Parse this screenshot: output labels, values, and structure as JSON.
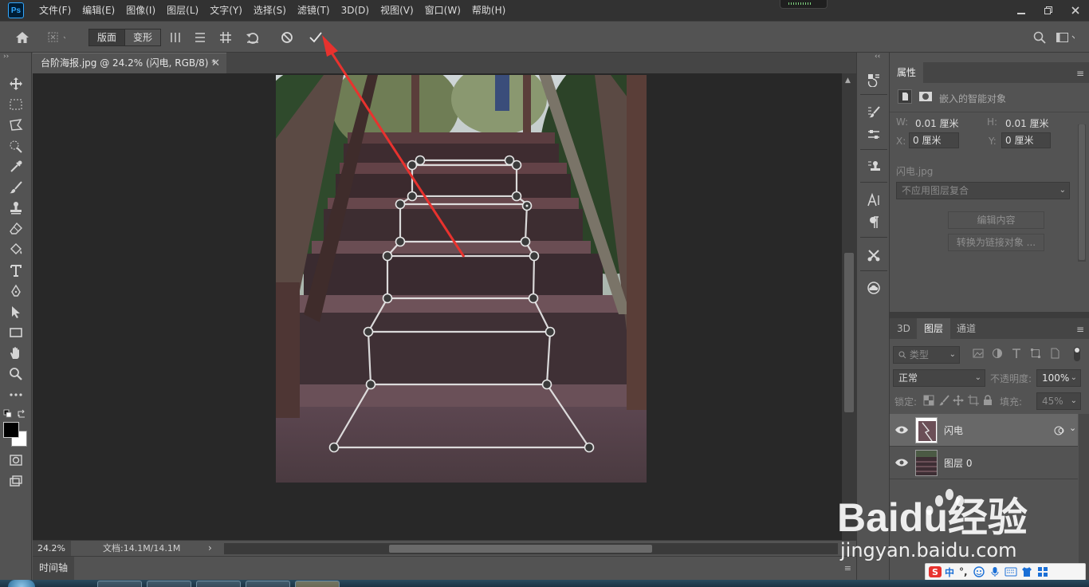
{
  "app": {
    "logo": "Ps",
    "menu": [
      "文件(F)",
      "编辑(E)",
      "图像(I)",
      "图层(L)",
      "文字(Y)",
      "选择(S)",
      "滤镜(T)",
      "3D(D)",
      "视图(V)",
      "窗口(W)",
      "帮助(H)"
    ],
    "window_controls": [
      "minimize",
      "restore",
      "close"
    ]
  },
  "options_bar": {
    "mode_segments": [
      "版面",
      "变形"
    ],
    "active_segment": "版面",
    "icons": [
      "home-icon",
      "puppet-warp-icon",
      "vertical-split-icon",
      "horizontal-split-icon",
      "grid-split-icon",
      "reset-icon",
      "cancel-icon",
      "commit-icon"
    ]
  },
  "document": {
    "tab_title": "台阶海报.jpg @ 24.2% (闪电, RGB/8) *",
    "zoom": "24.2%",
    "doc_size": "文档:14.1M/14.1M",
    "status_arrow": "›"
  },
  "timeline": {
    "tab_label": "时间轴"
  },
  "properties": {
    "tab": "属性",
    "subtitle": "嵌入的智能对象",
    "w_label": "W:",
    "w_value": "0.01 厘米",
    "h_label": "H:",
    "h_value": "0.01 厘米",
    "x_label": "X:",
    "x_value": "0 厘米",
    "y_label": "Y:",
    "y_value": "0 厘米",
    "filename": "闪电.jpg",
    "layer_comp": "不应用图层复合",
    "edit_button": "编辑内容",
    "convert_button": "转换为链接对象 ..."
  },
  "layers": {
    "tabs": [
      "3D",
      "图层",
      "通道"
    ],
    "active_tab": "图层",
    "filter_label": "类型",
    "blend_mode": "正常",
    "opacity_label": "不透明度:",
    "opacity_value": "100%",
    "lock_label": "锁定:",
    "fill_label": "填充:",
    "fill_value": "45%",
    "items": [
      {
        "name": "闪电",
        "selected": true
      },
      {
        "name": "图层 0",
        "selected": false
      }
    ]
  },
  "watermark": {
    "brand": "Baidu经验",
    "url": "jingyan.baidu.com"
  },
  "ime": {
    "logo": "S",
    "mode": "中",
    "punct": "°,"
  },
  "colors": {
    "accent_arrow": "#e8322e",
    "menubar_bg": "#323232",
    "panel_bg": "#535353",
    "canvas_bg": "#282828",
    "ps_blue": "#31a8ff"
  }
}
